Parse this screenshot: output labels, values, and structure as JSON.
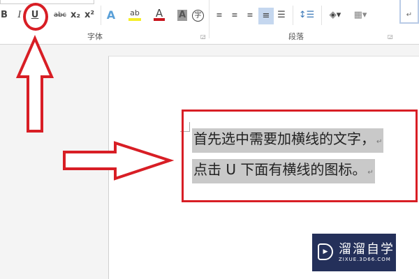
{
  "ribbon": {
    "font_group": {
      "label": "字体",
      "bold": "B",
      "italic": "I",
      "underline": "U",
      "strike": "abc",
      "subscript": "x₂",
      "superscript": "x²",
      "text_effect": "A",
      "highlight": "ab",
      "font_color": "A",
      "shading": "A",
      "enclose": "字"
    },
    "paragraph_group": {
      "label": "段落"
    },
    "style_preview_mark": "↵"
  },
  "document": {
    "lines": [
      "首先选中需要加横线的文字，",
      "点击 U 下面有横线的图标。"
    ],
    "paragraph_mark": "↵"
  },
  "watermark": {
    "name": "溜溜自学",
    "url": "ZIXUE.3D66.COM"
  },
  "colors": {
    "annotation": "#d81e25",
    "highlight": "#c9c9c9"
  }
}
